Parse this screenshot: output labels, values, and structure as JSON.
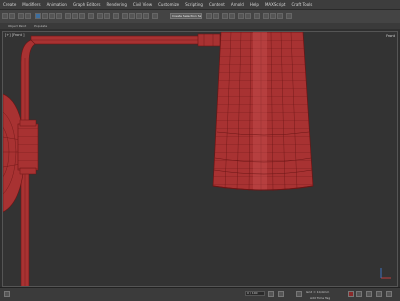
{
  "menubar": {
    "items": [
      "Create",
      "Modifiers",
      "Animation",
      "Graph Editors",
      "Rendering",
      "Civil View",
      "Customize",
      "Scripting",
      "Content",
      "Arnold",
      "Help",
      "MAXScript",
      "Craft Tools"
    ]
  },
  "toolbar": {
    "selection_set_value": "Create Selection Se"
  },
  "subbar": {
    "left_label": "Object Paint",
    "right_label": "Populate"
  },
  "viewport": {
    "label": "[+] [Front ]",
    "navcube_label": "Front",
    "model_color": "#a83232",
    "wire_color": "#6b1515"
  },
  "statusbar": {
    "frame_field": "0 / 100",
    "grid_text": "Grid = 10,0mm",
    "add_time_tag": "Add Time Tag",
    "key_filters": "Key Filters..."
  }
}
